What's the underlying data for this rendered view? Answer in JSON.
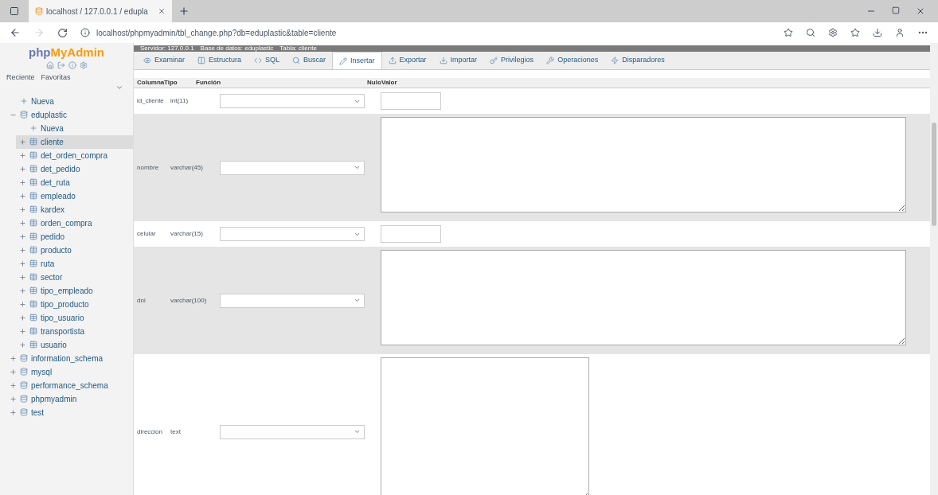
{
  "browser": {
    "tab_title": "localhost / 127.0.0.1 / edupla",
    "url": "localhost/phpmyadmin/tbl_change.php?db=eduplastic&table=cliente"
  },
  "sidebar": {
    "logo_left": "php",
    "logo_right": "MyAdmin",
    "links": [
      "Reciente",
      "Favoritas"
    ],
    "tree": [
      {
        "label": "Nueva",
        "kind": "new",
        "selected": false
      },
      {
        "label": "eduplastic",
        "kind": "db",
        "expanded": true,
        "selected": false,
        "children": [
          {
            "label": "Nueva",
            "kind": "new",
            "selected": false
          },
          {
            "label": "cliente",
            "kind": "table",
            "expanded": false,
            "selected": true
          },
          {
            "label": "det_orden_compra",
            "kind": "table",
            "expanded": false,
            "selected": false
          },
          {
            "label": "det_pedido",
            "kind": "table",
            "expanded": false,
            "selected": false
          },
          {
            "label": "det_ruta",
            "kind": "table",
            "expanded": false,
            "selected": false
          },
          {
            "label": "empleado",
            "kind": "table",
            "expanded": false,
            "selected": false
          },
          {
            "label": "kardex",
            "kind": "table",
            "expanded": false,
            "selected": false
          },
          {
            "label": "orden_compra",
            "kind": "table",
            "expanded": false,
            "selected": false
          },
          {
            "label": "pedido",
            "kind": "table",
            "expanded": false,
            "selected": false
          },
          {
            "label": "producto",
            "kind": "table",
            "expanded": false,
            "selected": false
          },
          {
            "label": "ruta",
            "kind": "table",
            "expanded": false,
            "selected": false
          },
          {
            "label": "sector",
            "kind": "table",
            "expanded": false,
            "selected": false
          },
          {
            "label": "tipo_empleado",
            "kind": "table",
            "expanded": false,
            "selected": false
          },
          {
            "label": "tipo_producto",
            "kind": "table",
            "expanded": false,
            "selected": false
          },
          {
            "label": "tipo_usuario",
            "kind": "table",
            "expanded": false,
            "selected": false
          },
          {
            "label": "transportista",
            "kind": "table",
            "expanded": false,
            "selected": false
          },
          {
            "label": "usuario",
            "kind": "table",
            "expanded": false,
            "selected": false
          }
        ]
      },
      {
        "label": "information_schema",
        "kind": "db",
        "expanded": false,
        "selected": false
      },
      {
        "label": "mysql",
        "kind": "db",
        "expanded": false,
        "selected": false
      },
      {
        "label": "performance_schema",
        "kind": "db",
        "expanded": false,
        "selected": false
      },
      {
        "label": "phpmyadmin",
        "kind": "db",
        "expanded": false,
        "selected": false
      },
      {
        "label": "test",
        "kind": "db",
        "expanded": false,
        "selected": false
      }
    ]
  },
  "breadcrumb": [
    "Servidor: 127.0.0.1",
    "Base de datos: eduplastic",
    "Tabla: cliente"
  ],
  "tabs": [
    {
      "label": "Examinar",
      "selected": false
    },
    {
      "label": "Estructura",
      "selected": false
    },
    {
      "label": "SQL",
      "selected": false
    },
    {
      "label": "Buscar",
      "selected": false
    },
    {
      "label": "Insertar",
      "selected": true
    },
    {
      "label": "Exportar",
      "selected": false
    },
    {
      "label": "Importar",
      "selected": false
    },
    {
      "label": "Privilegios",
      "selected": false
    },
    {
      "label": "Operaciones",
      "selected": false
    },
    {
      "label": "Disparadores",
      "selected": false
    }
  ],
  "table": {
    "columns": [
      "Columna",
      "Tipo",
      "Función",
      "Nulo",
      "Valor"
    ],
    "rows": [
      {
        "column": "id_cliente",
        "type": "int(11)",
        "kind": "input"
      },
      {
        "column": "nombre",
        "type": "varchar(45)",
        "kind": "textarea"
      },
      {
        "column": "celular",
        "type": "varchar(15)",
        "kind": "input"
      },
      {
        "column": "dni",
        "type": "varchar(100)",
        "kind": "textarea"
      },
      {
        "column": "direccion",
        "type": "text",
        "kind": "tall"
      }
    ]
  }
}
